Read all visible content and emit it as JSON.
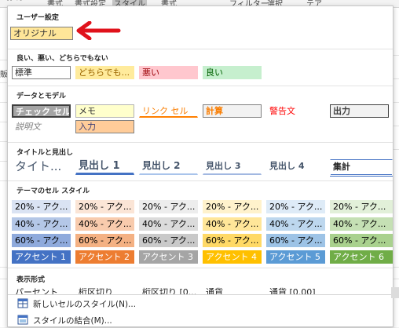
{
  "ribbon": {
    "items": [
      "書式",
      "書式設定",
      "スタイル",
      "書式",
      "フィルター",
      "選択",
      "テア"
    ]
  },
  "sheet": {
    "row_label": "販"
  },
  "gallery": {
    "user_section": {
      "title": "ユーザー設定",
      "custom_style": "オリジナル"
    },
    "gbn_section": {
      "title": "良い、悪い、どちらでもない",
      "cells": [
        "標準",
        "どちらでも...",
        "悪い",
        "良い"
      ]
    },
    "data_section": {
      "title": "データとモデル",
      "row1": [
        "チェック セル",
        "メモ",
        "リンク セル",
        "計算",
        "警告文",
        "出力"
      ],
      "row2": [
        "説明文",
        "入力"
      ]
    },
    "title_section": {
      "title": "タイトルと見出し",
      "cells": [
        "タイト...",
        "見出し 1",
        "見出し 2",
        "見出し 3",
        "見出し 4",
        "集計"
      ]
    },
    "theme_section": {
      "title": "テーマのセル スタイル",
      "rows": [
        [
          "20% - アク...",
          "20% - アク...",
          "20% - アク...",
          "20% - アク...",
          "20% - アク...",
          "20% - アク..."
        ],
        [
          "40% - アク...",
          "40% - アク...",
          "40% - アク...",
          "40% - アク...",
          "40% - アク...",
          "40% - アク..."
        ],
        [
          "60% - アク...",
          "60% - アク...",
          "60% - アク...",
          "60% - アク...",
          "60% - アク...",
          "60% - アク..."
        ],
        [
          "アクセント 1",
          "アクセント 2",
          "アクセント 3",
          "アクセント 4",
          "アクセント 5",
          "アクセント 6"
        ]
      ],
      "colors": {
        "p20": [
          "#dae3f3",
          "#fbe5d6",
          "#ededed",
          "#fff2cc",
          "#deebf7",
          "#e2f0d9"
        ],
        "p40": [
          "#b4c7e7",
          "#f8cbad",
          "#dbdbdb",
          "#ffe699",
          "#bdd7ee",
          "#c5e0b4"
        ],
        "p60": [
          "#8faadc",
          "#f4b183",
          "#c9c9c9",
          "#ffd966",
          "#9dc3e6",
          "#a9d18e"
        ],
        "accent": [
          "#4472c4",
          "#ed7d31",
          "#a5a5a5",
          "#ffc000",
          "#5b9bd5",
          "#70ad47"
        ]
      }
    },
    "format_section": {
      "title": "表示形式",
      "cells": [
        "パーセント",
        "桁区切り",
        "桁区切り [0...",
        "通貨",
        "通貨 [0.00]"
      ]
    },
    "menu": {
      "new_style": "新しいセルのスタイル(N)...",
      "merge_styles": "スタイルの結合(M)..."
    }
  }
}
